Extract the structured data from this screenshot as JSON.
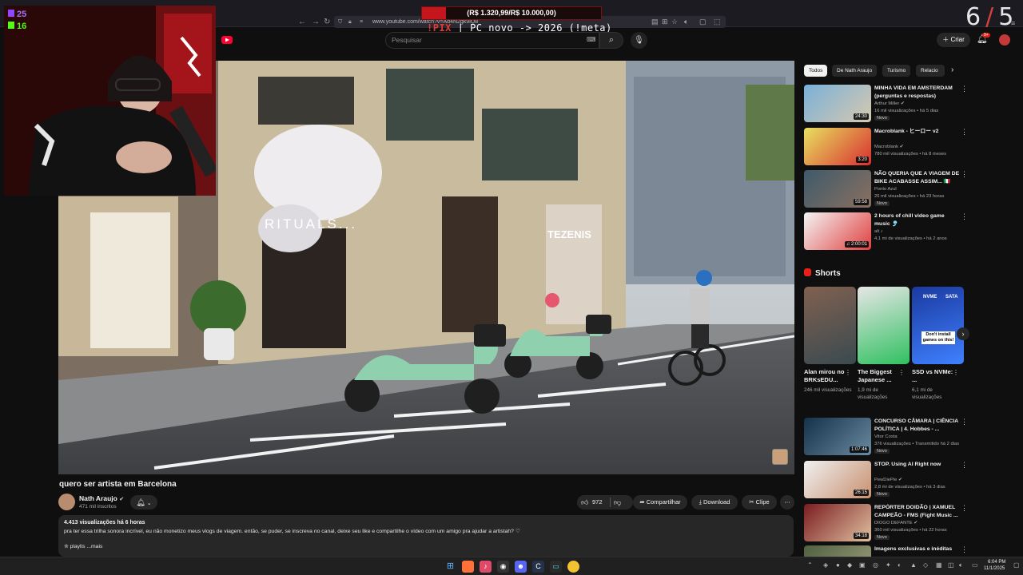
{
  "browser": {
    "url": "www.youtube.com/watch?v=Ad4N2gk9iQ8",
    "nav_back": "←",
    "nav_forward": "→",
    "nav_reload": "↻"
  },
  "stream_overlay": {
    "donation_text": "(R$ 1.320,99/R$ 10.000,00)",
    "donation_progress": 0.132,
    "ticker_pix": "!PIX",
    "ticker_text": " | PC novo -> 2026 (!meta)",
    "counter_left": "6",
    "counter_slash": "/",
    "counter_right": "5",
    "twitch_count": "25",
    "kick_count": "16"
  },
  "header": {
    "search_placeholder": "Pesquisar",
    "create_label": "Criar",
    "notification_count": "9+"
  },
  "video": {
    "storefront_text": "RITUALS...",
    "store2_text": "TEZENIS",
    "title": "quero ser artista em Barcelona",
    "channel_name": "Nath Araujo",
    "channel_subs": "471 mil inscritos",
    "likes": "972",
    "share_label": "Compartilhar",
    "download_label": "Download",
    "clip_label": "Clipe",
    "stats": "4.413 visualizações  há 6 horas",
    "description": "pra ter essa trilha sonora incrível, eu não monetizo meus vlogs de viagem. então, se puder, se inscreva no canal, deixe seu like e compartilhe o vídeo com um amigo pra ajudar a artistah? ♡",
    "more_label": "✮ playlis  ...mais"
  },
  "chips": [
    {
      "label": "Todos",
      "active": true
    },
    {
      "label": "De Nath Araujo"
    },
    {
      "label": "Turismo"
    },
    {
      "label": "Relacio"
    }
  ],
  "recommendations": [
    {
      "title": "MINHA VIDA EM AMSTERDAM (perguntas e respostas)",
      "channel": "Arthur Miller ✔",
      "meta": "16 mil visualizações • há 5 dias",
      "badge": "Novo",
      "duration": "24:30",
      "colors": [
        "#7ab0d8",
        "#d6c9b0"
      ]
    },
    {
      "title": "Macroblank - ヒーロー v2",
      "channel": "Macroblank ✔",
      "meta": "780 mil visualizações • há 8 meses",
      "badge": "",
      "duration": "3:20",
      "colors": [
        "#e8e060",
        "#d83030"
      ]
    },
    {
      "title": "NÃO QUERIA QUE A VIAGEM DE BIKE ACABASSE ASSIM... 🇮🇹",
      "channel": "Ponto Azul",
      "meta": "26 mil visualizações • há 23 horas",
      "badge": "Novo",
      "duration": "59:58",
      "colors": [
        "#3e5a6a",
        "#8a7060"
      ]
    },
    {
      "title": "2 hours of chill video game music 🎐",
      "channel": "alt ♪",
      "meta": "4,1 mi de visualizações • há 2 anos",
      "badge": "",
      "duration": "♫ 2:00:01",
      "colors": [
        "#f4f4f4",
        "#e04040"
      ]
    },
    {
      "title": "CONCURSO CÂMARA | CIÊNCIA POLÍTICA | 4. Hobbes - ...",
      "channel": "Vitor Costa",
      "meta": "376 visualizações • Transmitido há 2 dias",
      "badge": "Novo",
      "duration": "1:07:46",
      "colors": [
        "#14324a",
        "#6a8aa0"
      ]
    },
    {
      "title": "STOP. Using AI Right now",
      "channel": "PewDiePie ✔",
      "meta": "2,8 mi de visualizações • há 3 dias",
      "badge": "Novo",
      "duration": "26:15",
      "colors": [
        "#f0f0f0",
        "#c89070"
      ]
    },
    {
      "title": "REPÓRTER DOIDÃO | XAMUEL CAMPEÃO - FMS (Fight Music ...",
      "channel": "DIOGO DEFANTE ✔",
      "meta": "360 mil visualizações • há 22 horas",
      "badge": "Novo",
      "duration": "34:18",
      "colors": [
        "#7a1c20",
        "#e0c0a0"
      ]
    },
    {
      "title": "Imagens exclusivas e inéditas",
      "channel": "",
      "meta": "",
      "badge": "",
      "duration": "",
      "colors": [
        "#506040",
        "#a0a080"
      ]
    }
  ],
  "shorts": {
    "header": "Shorts",
    "items": [
      {
        "title": "Alan mirou no BRKsEDU...",
        "views": "246 mil visualizações",
        "colors": [
          "#806050",
          "#3a4a50"
        ]
      },
      {
        "title": "The Biggest Japanese ...",
        "views": "1,9 mi de visualizações",
        "colors": [
          "#e6e6e6",
          "#30c060"
        ]
      },
      {
        "title": "SSD vs NVMe: ...",
        "views": "6,1 mi de visualizações",
        "colors": [
          "#1a3aa0",
          "#4080ff"
        ],
        "overlay": "Don't install games on this!",
        "tags": [
          "NVME",
          "SATA"
        ]
      }
    ]
  },
  "taskbar": {
    "time": "6:04 PM",
    "date": "11/1/2025"
  }
}
